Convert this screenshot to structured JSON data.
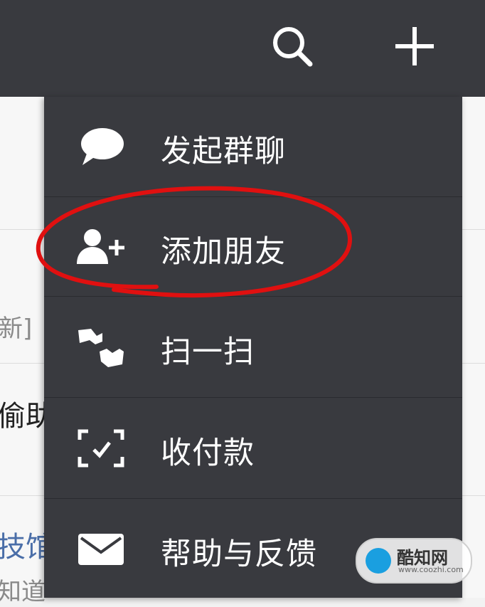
{
  "topbar": {
    "search_icon": "search-icon",
    "add_icon": "plus-icon",
    "background": "#393a3f"
  },
  "background_list": {
    "row1_fragment": "新]",
    "row2_fragment": "偷助",
    "row3_fragment": "技馆",
    "row3_sub_fragment": "知道"
  },
  "menu": {
    "background": "#393a3f",
    "items": [
      {
        "label": "发起群聊",
        "icon": "chat-bubble-icon"
      },
      {
        "label": "添加朋友",
        "icon": "add-friend-icon"
      },
      {
        "label": "扫一扫",
        "icon": "scan-icon"
      },
      {
        "label": "收付款",
        "icon": "payment-scan-icon"
      },
      {
        "label": "帮助与反馈",
        "icon": "envelope-icon"
      }
    ]
  },
  "annotation": {
    "color": "#e01010"
  },
  "watermark": {
    "brand": "酷知网",
    "url": "www.coozhi.com"
  }
}
